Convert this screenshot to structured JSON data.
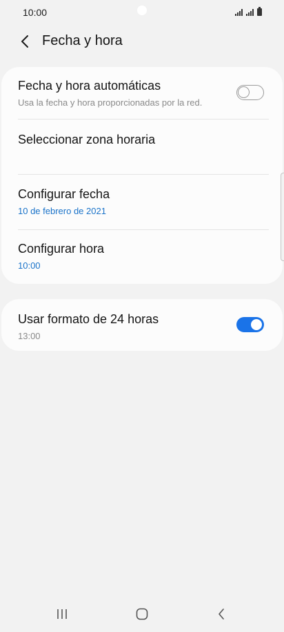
{
  "status_bar": {
    "time": "10:00",
    "icons": [
      "signal-icon",
      "signal-icon",
      "battery-icon"
    ]
  },
  "header": {
    "title": "Fecha y hora",
    "back_icon": "back-arrow-icon"
  },
  "settings": {
    "auto_datetime": {
      "title": "Fecha y hora automáticas",
      "subtitle": "Usa la fecha y hora proporcionadas por la red.",
      "enabled": false
    },
    "select_timezone": {
      "title": "Seleccionar zona horaria"
    },
    "set_date": {
      "title": "Configurar fecha",
      "value": "10 de febrero de 2021"
    },
    "set_time": {
      "title": "Configurar hora",
      "value": "10:00"
    },
    "format_24h": {
      "title": "Usar formato de 24 horas",
      "subtitle": "13:00",
      "enabled": true
    }
  },
  "nav_bar": {
    "buttons": [
      "recents-icon",
      "home-icon",
      "back-icon"
    ]
  },
  "colors": {
    "background": "#f2f2f2",
    "card": "#fcfcfc",
    "accent": "#1a73e8",
    "value_text": "#1a73c9"
  }
}
